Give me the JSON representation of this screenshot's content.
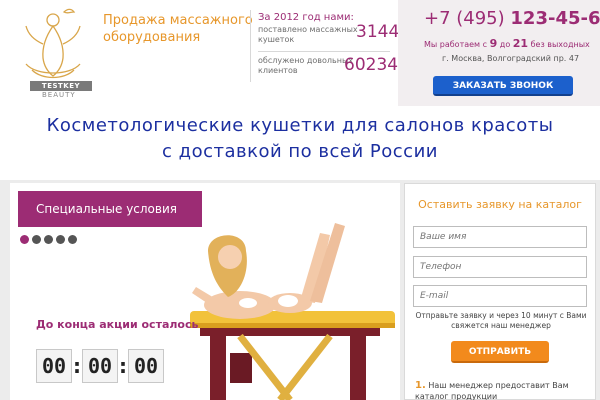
{
  "logo": {
    "icon": "lotus-figure-icon",
    "badge": "TESTKEY",
    "sub": "BEAUTY"
  },
  "brand": {
    "title": "Продажа массажного оборудования"
  },
  "stats": {
    "heading": "За 2012 год нами:",
    "items": [
      {
        "label": "поставлено массажных кушеток",
        "value": "3144"
      },
      {
        "label": "обслужено довольных клиентов",
        "value": "60234"
      }
    ]
  },
  "contact": {
    "phone_code": "+7 (495)",
    "phone_number": "123-45-69",
    "hours_prefix": "Мы работаем с",
    "hours_from": "9",
    "hours_mid": "до",
    "hours_to": "21",
    "hours_suffix": "без выходных",
    "address": "г. Москва, Волгоградский пр. 47",
    "call_button": "ЗАКАЗАТЬ ЗВОНОК"
  },
  "headline": {
    "line1": "Косметологические кушетки для салонов красоты",
    "line2": "с доставкой по всей России"
  },
  "promo": {
    "tab_label": "Специальные условия",
    "slides": 5,
    "active_slide": 1,
    "countdown_label": "До конца акции осталось",
    "timer": {
      "hours": "00",
      "minutes": "00",
      "seconds": "00"
    },
    "image_subject": "woman-on-massage-table"
  },
  "form": {
    "title": "Оставить заявку на каталог",
    "name_placeholder": "Ваше имя",
    "phone_placeholder": "Телефон",
    "email_placeholder": "E-mail",
    "note": "Отправьте заявку и через 10 минут с Вами свяжется наш менеджер",
    "submit": "ОТПРАВИТЬ",
    "step_number": "1.",
    "step_text": "Наш менеджер предоставит Вам каталог продукции"
  },
  "colors": {
    "accent": "#9c2c74",
    "orange": "#e7972b",
    "blue": "#1c2fa0",
    "button_blue": "#1c60cc",
    "button_orange": "#f28a1c"
  }
}
